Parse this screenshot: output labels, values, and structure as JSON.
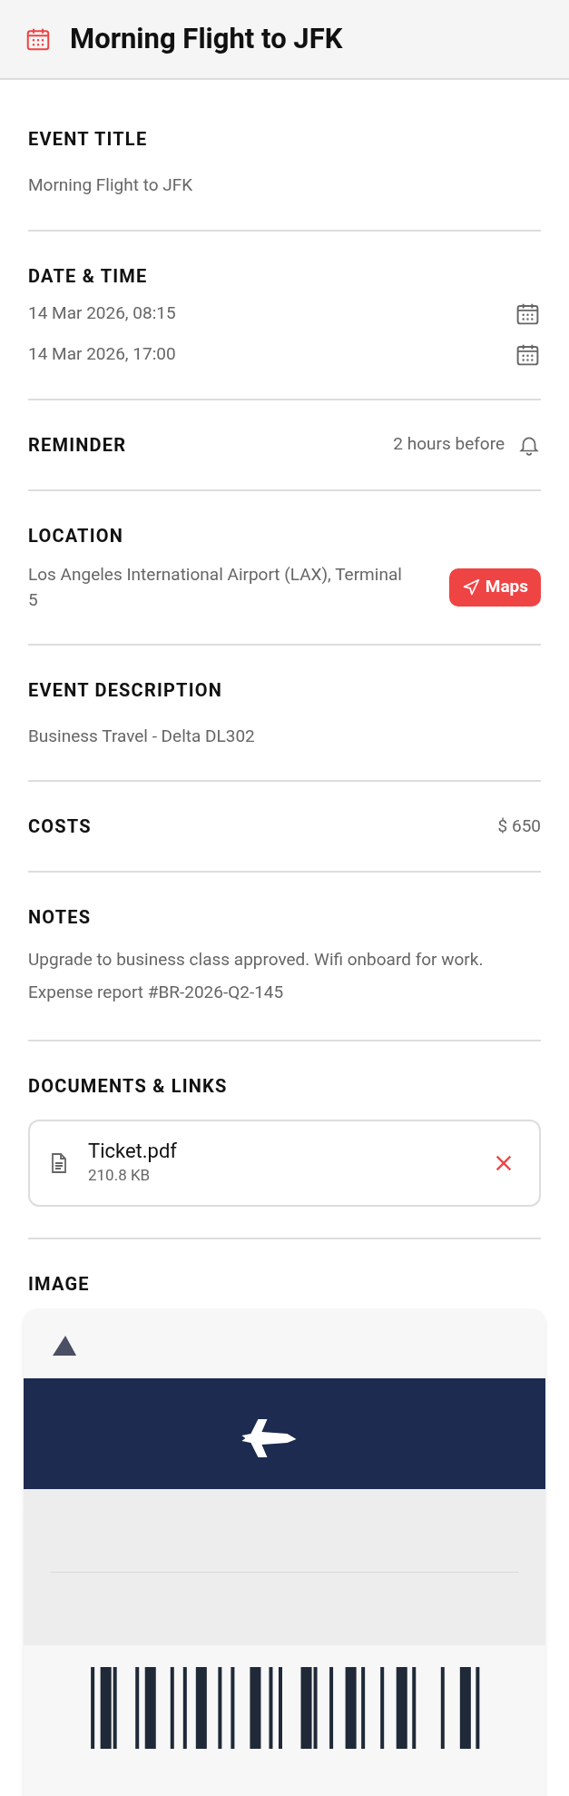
{
  "header": {
    "title": "Morning Flight to JFK"
  },
  "sections": [
    {
      "kind": "text",
      "label": "EVENT TITLE",
      "value": "Morning Flight to JFK"
    },
    {
      "kind": "dates",
      "label": "DATE & TIME",
      "dates": [
        "14 Mar 2026, 08:15",
        "14 Mar 2026, 17:00"
      ]
    },
    {
      "kind": "reminder",
      "label": "REMINDER",
      "value": "2 hours before"
    },
    {
      "kind": "location",
      "label": "LOCATION",
      "value": "Los Angeles International Airport (LAX), Terminal 5",
      "button": "Maps"
    },
    {
      "kind": "text",
      "label": "EVENT DESCRIPTION",
      "value": "Business Travel - Delta DL302"
    },
    {
      "kind": "inline",
      "label": "COSTS",
      "value": "$ 650"
    },
    {
      "kind": "paragraph",
      "label": "NOTES",
      "value": "Upgrade to business class approved. Wifi onboard for work. Expense report #BR-2026-Q2-145"
    },
    {
      "kind": "documents",
      "label": "DOCUMENTS & LINKS",
      "files": [
        {
          "name": "Ticket.pdf",
          "size": "210.8 KB"
        }
      ]
    },
    {
      "label": "IMAGE"
    }
  ]
}
